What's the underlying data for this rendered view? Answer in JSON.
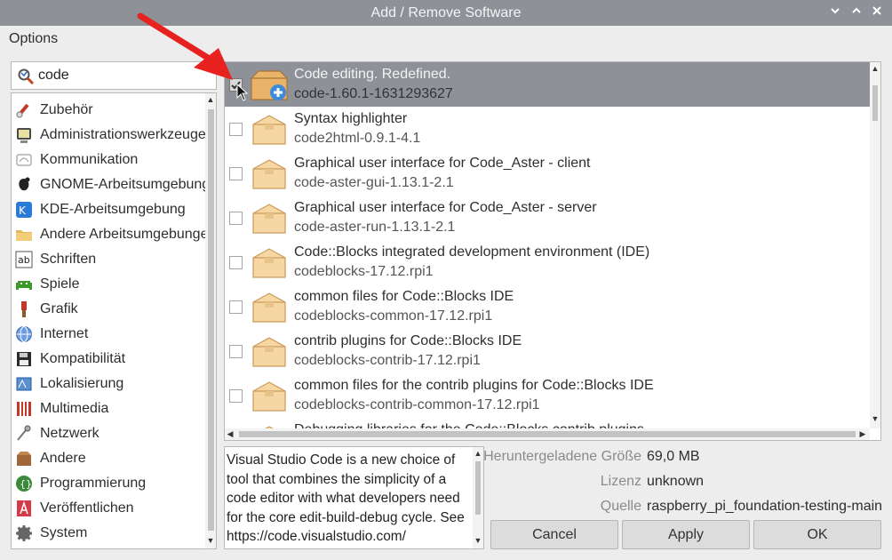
{
  "window": {
    "title": "Add / Remove Software"
  },
  "menu": {
    "options": "Options"
  },
  "search": {
    "value": "code"
  },
  "categories": [
    {
      "label": "Zubehör",
      "icon": "accessories-icon"
    },
    {
      "label": "Administrationswerkzeuge",
      "icon": "admin-tools-icon"
    },
    {
      "label": "Kommunikation",
      "icon": "communication-icon"
    },
    {
      "label": "GNOME-Arbeitsumgebung",
      "icon": "gnome-icon"
    },
    {
      "label": "KDE-Arbeitsumgebung",
      "icon": "kde-icon"
    },
    {
      "label": "Andere Arbeitsumgebungen",
      "icon": "folder-icon"
    },
    {
      "label": "Schriften",
      "icon": "fonts-icon"
    },
    {
      "label": "Spiele",
      "icon": "games-icon"
    },
    {
      "label": "Grafik",
      "icon": "graphics-icon"
    },
    {
      "label": "Internet",
      "icon": "globe-icon"
    },
    {
      "label": "Kompatibilität",
      "icon": "floppy-icon"
    },
    {
      "label": "Lokalisierung",
      "icon": "localization-icon"
    },
    {
      "label": "Multimedia",
      "icon": "multimedia-icon"
    },
    {
      "label": "Netzwerk",
      "icon": "network-icon"
    },
    {
      "label": "Andere",
      "icon": "box-icon"
    },
    {
      "label": "Programmierung",
      "icon": "programming-icon"
    },
    {
      "label": "Veröffentlichen",
      "icon": "publishing-icon"
    },
    {
      "label": "System",
      "icon": "gear-icon"
    }
  ],
  "packages": [
    {
      "title": "Code editing. Redefined.",
      "version": "code-1.60.1-1631293627",
      "checked": true,
      "selected": true
    },
    {
      "title": "Syntax highlighter",
      "version": "code2html-0.9.1-4.1",
      "checked": false,
      "selected": false
    },
    {
      "title": "Graphical user interface for Code_Aster - client",
      "version": "code-aster-gui-1.13.1-2.1",
      "checked": false,
      "selected": false
    },
    {
      "title": "Graphical user interface for Code_Aster - server",
      "version": "code-aster-run-1.13.1-2.1",
      "checked": false,
      "selected": false
    },
    {
      "title": "Code::Blocks integrated development environment (IDE)",
      "version": "codeblocks-17.12.rpi1",
      "checked": false,
      "selected": false
    },
    {
      "title": "common files for Code::Blocks IDE",
      "version": "codeblocks-common-17.12.rpi1",
      "checked": false,
      "selected": false
    },
    {
      "title": "contrib plugins for Code::Blocks IDE",
      "version": "codeblocks-contrib-17.12.rpi1",
      "checked": false,
      "selected": false
    },
    {
      "title": "common files for the contrib plugins for Code::Blocks IDE",
      "version": "codeblocks-contrib-common-17.12.rpi1",
      "checked": false,
      "selected": false
    },
    {
      "title": "Debugging libraries for the Code::Blocks contrib plugins",
      "version": "",
      "checked": false,
      "selected": false
    }
  ],
  "description": {
    "text": "Visual Studio Code is a new choice of tool that combines the simplicity of a code editor with what developers need for the core edit-build-debug cycle. See https://code.visualstudio.com/"
  },
  "info": {
    "size_label": "Heruntergeladene Größe",
    "size_value": "69,0 MB",
    "license_label": "Lizenz",
    "license_value": "unknown",
    "source_label": "Quelle",
    "source_value": "raspberry_pi_foundation-testing-main"
  },
  "buttons": {
    "cancel": "Cancel",
    "apply": "Apply",
    "ok": "OK"
  },
  "colors": {
    "titlebar": "#8e9198",
    "selection": "#8e9198",
    "annotation_arrow": "#e8231f"
  }
}
